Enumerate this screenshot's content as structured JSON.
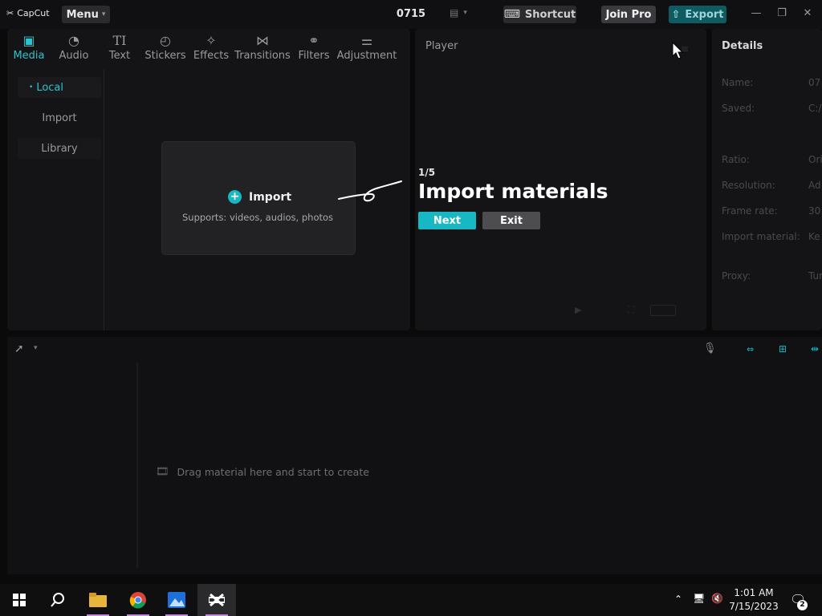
{
  "app": {
    "logo_text": "CapCut",
    "menu_label": "Menu",
    "project_title": "0715",
    "shortcut_label": "Shortcut",
    "join_pro_label": "Join Pro",
    "export_label": "Export"
  },
  "media_tabs": [
    {
      "label": "Media",
      "icon": "media-icon"
    },
    {
      "label": "Audio",
      "icon": "audio-icon"
    },
    {
      "label": "Text",
      "icon": "text-icon"
    },
    {
      "label": "Stickers",
      "icon": "stickers-icon"
    },
    {
      "label": "Effects",
      "icon": "effects-icon"
    },
    {
      "label": "Transitions",
      "icon": "transitions-icon"
    },
    {
      "label": "Filters",
      "icon": "filters-icon"
    },
    {
      "label": "Adjustment",
      "icon": "adjustment-icon"
    }
  ],
  "sidebar": {
    "items": [
      {
        "label": "Local"
      },
      {
        "label": "Import"
      },
      {
        "label": "Library"
      }
    ]
  },
  "import_card": {
    "label": "Import",
    "supports": "Supports: videos, audios, photos"
  },
  "player": {
    "title": "Player"
  },
  "details": {
    "title": "Details",
    "rows": [
      {
        "label": "Name:",
        "value": "07"
      },
      {
        "label": "Saved:",
        "value": "C:/"
      },
      {
        "label": "Ratio:",
        "value": "Ori"
      },
      {
        "label": "Resolution:",
        "value": "Ad"
      },
      {
        "label": "Frame rate:",
        "value": "30"
      },
      {
        "label": "Import material:",
        "value": "Ke"
      },
      {
        "label": "Proxy:",
        "value": "Tur"
      }
    ]
  },
  "onboarding": {
    "step": "1/5",
    "title": "Import materials",
    "next_label": "Next",
    "exit_label": "Exit"
  },
  "timeline": {
    "empty_hint": "Drag material here and start to create"
  },
  "taskbar": {
    "time": "1:01 AM",
    "date": "7/15/2023",
    "notification_count": "2"
  },
  "colors": {
    "accent": "#17b8c4",
    "background": "#0a0a0b",
    "panel": "#141416"
  }
}
